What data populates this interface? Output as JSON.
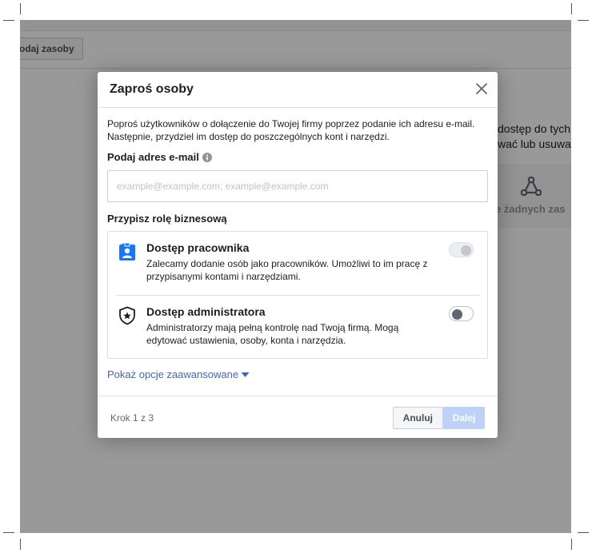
{
  "background": {
    "button_label": "odaj zasoby",
    "right_text_line1": "dostęp do tych",
    "right_text_line2": "wać lub usuwać",
    "card_text": "e żadnych zas",
    "card_icon": "network-icon"
  },
  "dialog": {
    "title": "Zaproś osoby",
    "intro": "Poproś użytkowników o dołączenie do Twojej firmy poprzez podanie ich adresu e-mail. Następnie, przydziel im dostęp do poszczególnych kont i narzędzi.",
    "email_label": "Podaj adres e-mail",
    "email_placeholder": "example@example.com; example@example.com",
    "email_value": "",
    "role_label": "Przypisz rolę biznesową",
    "roles": [
      {
        "title": "Dostęp pracownika",
        "description": "Zalecamy dodanie osób jako pracowników. Umożliwi to im pracę z przypisanymi kontami i narzędziami.",
        "icon": "employee-badge-icon",
        "toggle_state": "disabled"
      },
      {
        "title": "Dostęp administratora",
        "description": "Administratorzy mają pełną kontrolę nad Twoją firmą. Mogą edytować ustawienia, osoby, konta i narzędzia.",
        "icon": "admin-shield-icon",
        "toggle_state": "off"
      }
    ],
    "advanced_link": "Pokaż opcje zaawansowane",
    "step_text": "Krok 1 z 3",
    "cancel_label": "Anuluj",
    "next_label": "Dalej"
  },
  "colors": {
    "link": "#4267b2",
    "primary_disabled": "#bed2f7",
    "employee_icon": "#1877f2"
  }
}
